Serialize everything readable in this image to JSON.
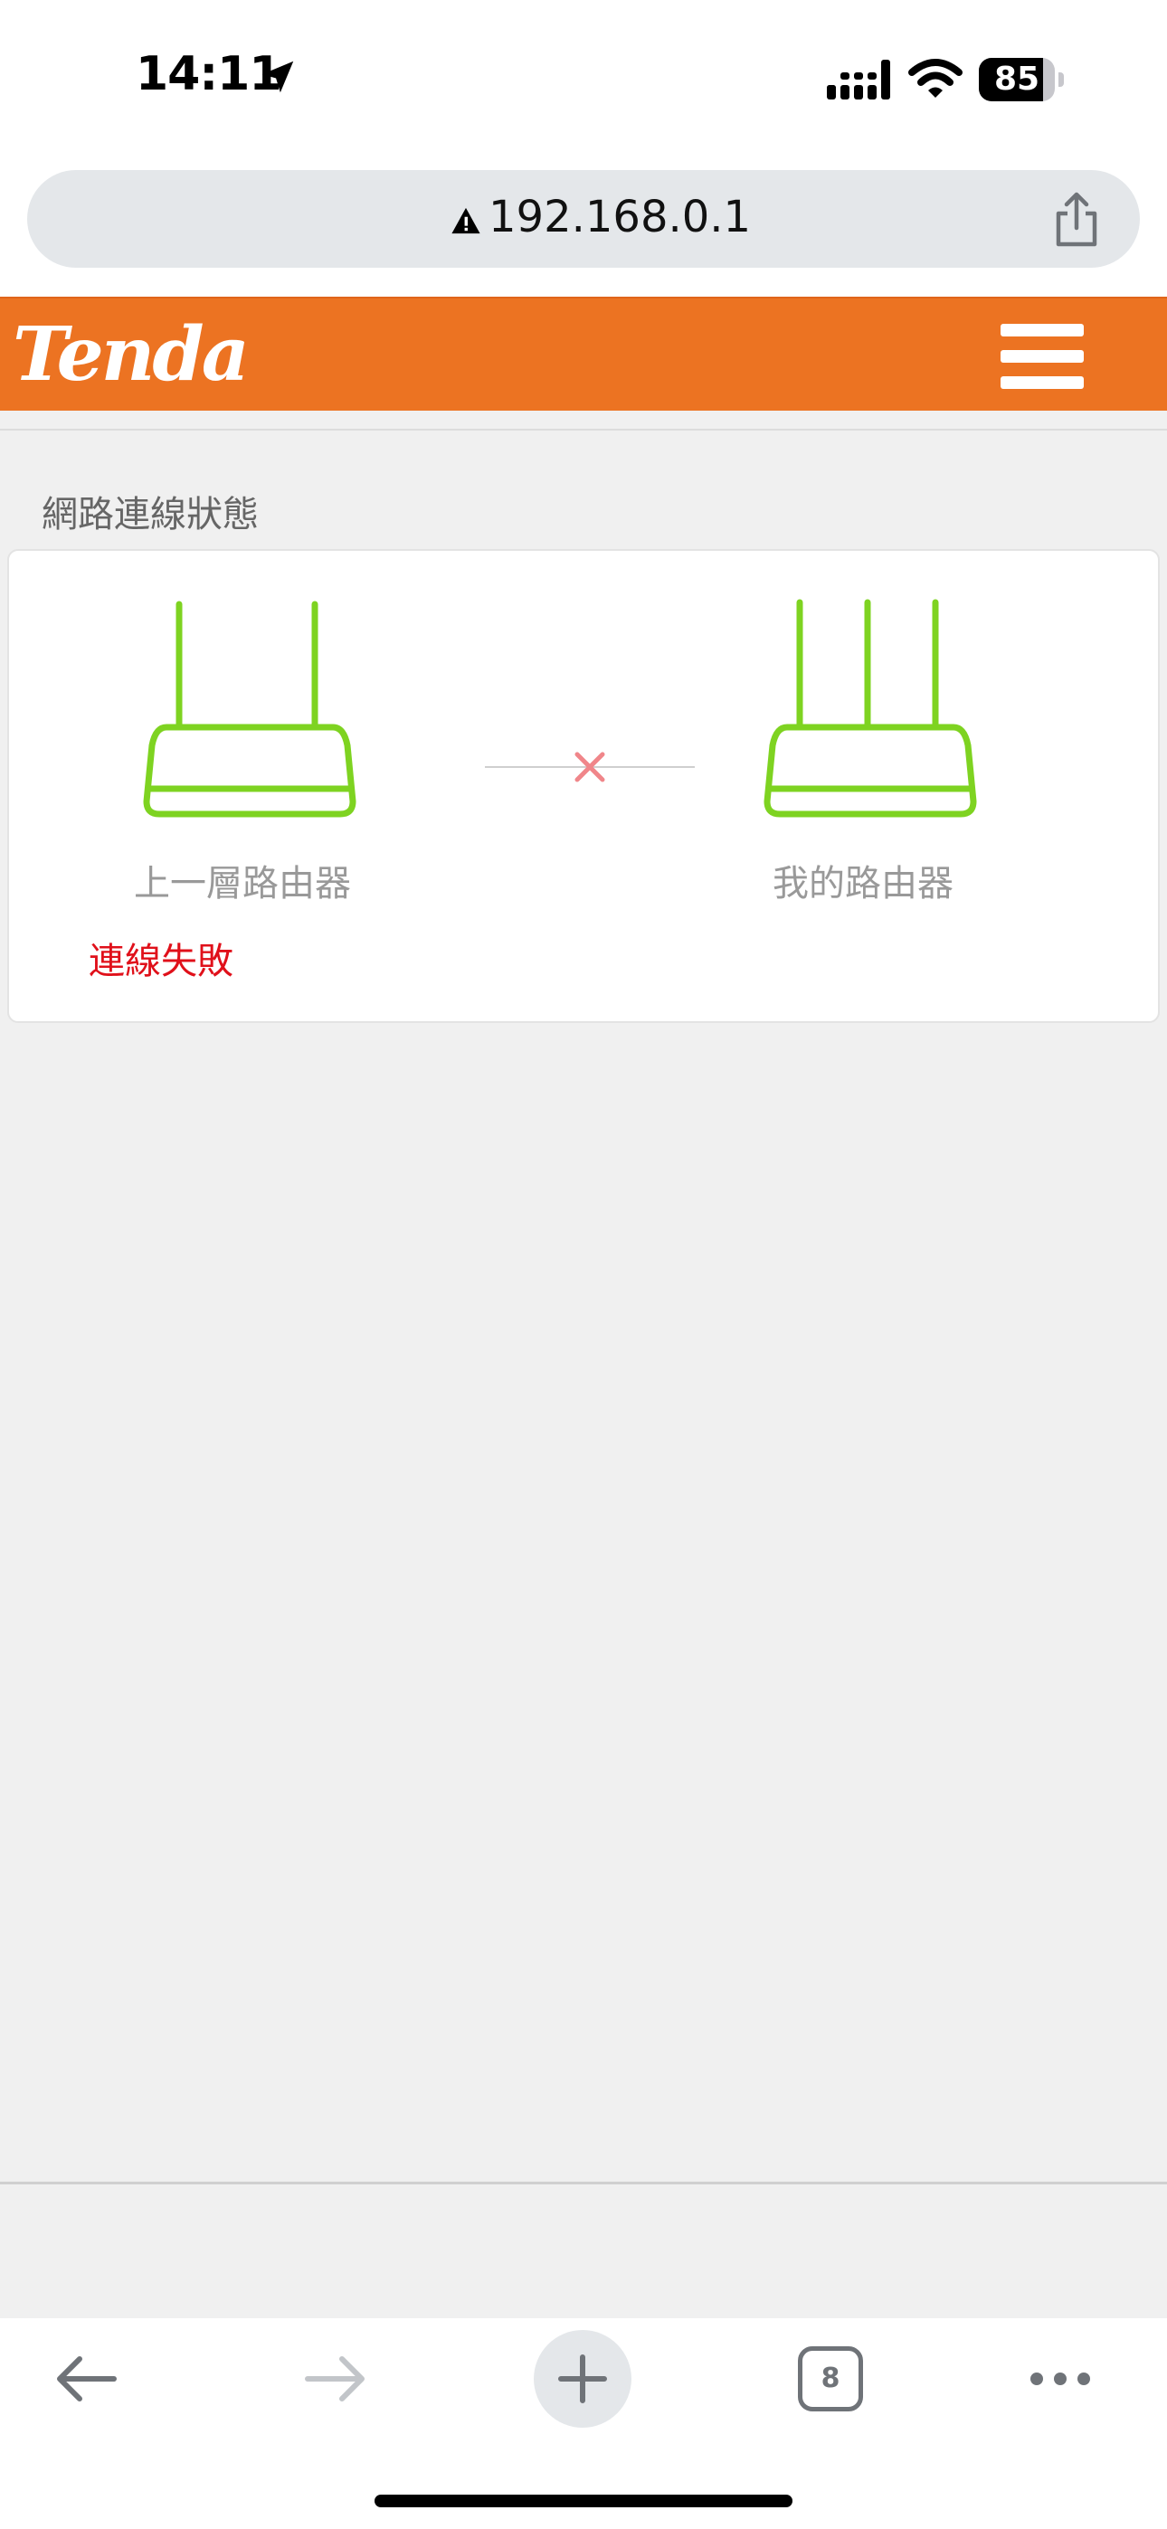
{
  "status_bar": {
    "time": "14:11",
    "battery": "85",
    "battery_level": 0.85
  },
  "browser": {
    "url": "192.168.0.1",
    "open_tabs": "8"
  },
  "header": {
    "brand": "Tenda"
  },
  "network_status": {
    "section_title": "網路連線狀態",
    "upstream_router_label": "上一層路由器",
    "my_router_label": "我的路由器",
    "connection_status": "連線失敗"
  },
  "colors": {
    "brand_orange": "#ec7322",
    "router_green": "#7ed321",
    "error_red": "#e0101a",
    "x_mark_red": "#f0868a"
  },
  "icons": [
    "location-arrow-icon",
    "signal-icon",
    "wifi-icon",
    "warning-icon",
    "share-icon",
    "menu-icon",
    "router-icon",
    "close-icon",
    "back-arrow-icon",
    "forward-arrow-icon",
    "plus-icon",
    "more-icon"
  ]
}
